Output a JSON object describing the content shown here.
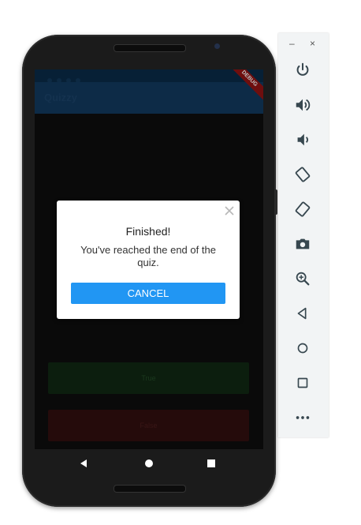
{
  "app": {
    "title": "Quizzy",
    "debug_banner": "DEBUG"
  },
  "dialog": {
    "title": "Finished!",
    "message": "You've reached the end of the quiz.",
    "button": "CANCEL",
    "close_icon": "close-icon"
  },
  "answers": {
    "true_label": "True",
    "false_label": "False"
  },
  "nav": {
    "back_icon": "back-icon",
    "home_icon": "home-icon",
    "recents_icon": "recents-icon"
  },
  "toolbar": {
    "minimize": "–",
    "close": "×",
    "items": [
      "power-icon",
      "volume-up-icon",
      "volume-down-icon",
      "rotate-left-icon",
      "rotate-right-icon",
      "camera-icon",
      "zoom-icon",
      "back-icon",
      "home-icon",
      "overview-icon",
      "more-icon"
    ]
  },
  "colors": {
    "accent": "#2196f3",
    "toolbar_icon": "#37474f"
  }
}
